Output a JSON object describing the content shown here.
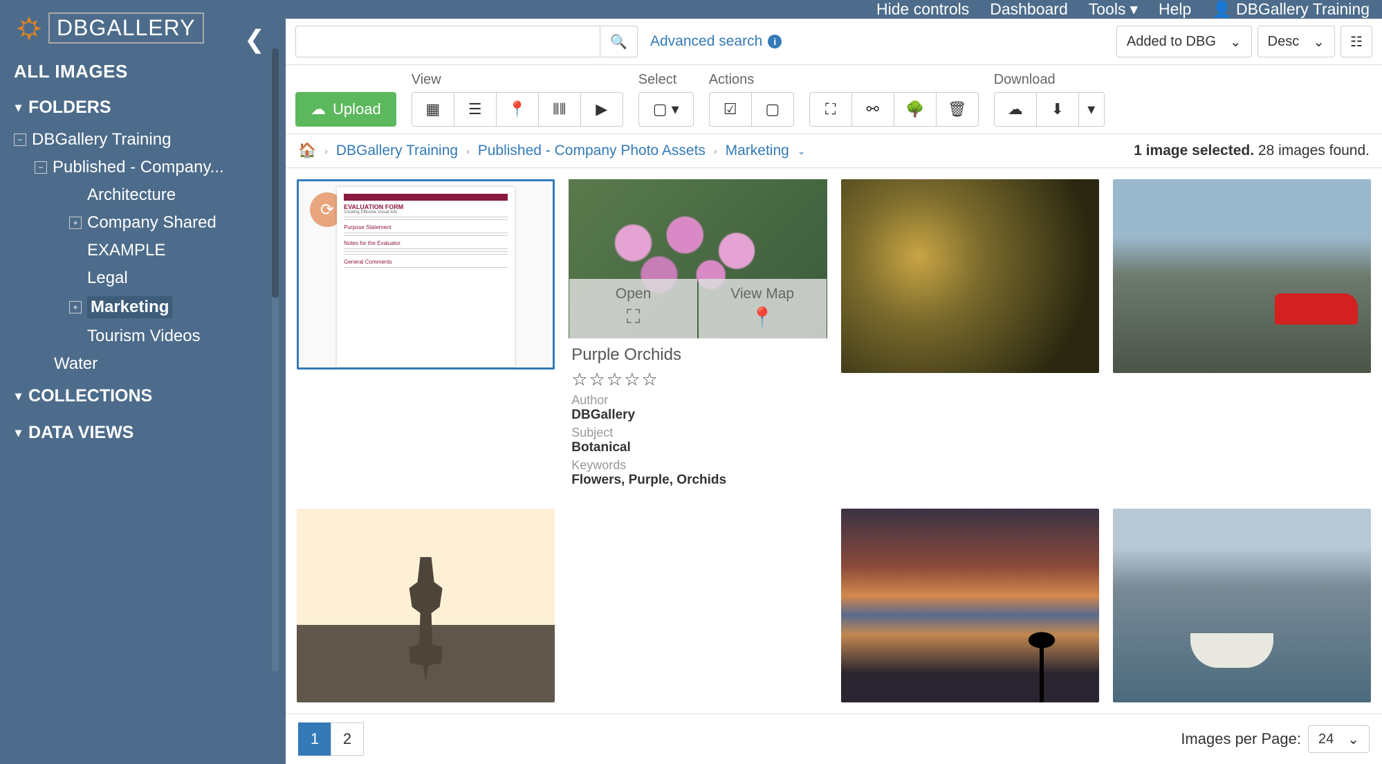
{
  "logo": {
    "text": "DBGALLERY"
  },
  "sidebar": {
    "all_images": "ALL IMAGES",
    "folders": "FOLDERS",
    "root": "DBGallery Training",
    "published": "Published - Company...",
    "leaves": {
      "architecture": "Architecture",
      "company_shared": "Company Shared",
      "example": "EXAMPLE",
      "legal": "Legal",
      "marketing": "Marketing",
      "tourism": "Tourism Videos",
      "water": "Water"
    },
    "collections": "COLLECTIONS",
    "data_views": "DATA VIEWS"
  },
  "topbar": {
    "hide_controls": "Hide controls",
    "dashboard": "Dashboard",
    "tools": "Tools",
    "help": "Help",
    "user": "DBGallery Training"
  },
  "search": {
    "placeholder": "",
    "advanced": "Advanced search",
    "sort": "Added to DBG",
    "order": "Desc"
  },
  "toolbar": {
    "upload": "Upload",
    "view": "View",
    "select": "Select",
    "actions": "Actions",
    "download": "Download"
  },
  "breadcrumb": {
    "root": "DBGallery Training",
    "mid": "Published - Company Photo Assets",
    "leaf": "Marketing",
    "selected": "1 image selected.",
    "found": "28 images found."
  },
  "hover": {
    "open": "Open",
    "view_map": "View Map",
    "title": "Purple Orchids",
    "author_lbl": "Author",
    "author": "DBGallery",
    "subject_lbl": "Subject",
    "subject": "Botanical",
    "keywords_lbl": "Keywords",
    "keywords": "Flowers, Purple, Orchids"
  },
  "pager": {
    "p1": "1",
    "p2": "2",
    "per_page_lbl": "Images per Page:",
    "per_page": "24"
  }
}
